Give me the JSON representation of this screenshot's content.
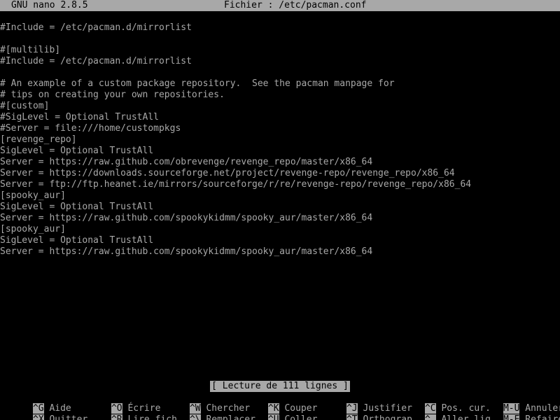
{
  "app": {
    "name_version": "GNU nano 2.8.5",
    "file_label": "Fichier : /etc/pacman.conf"
  },
  "editor": {
    "lines": [
      "#Include = /etc/pacman.d/mirrorlist",
      "",
      "#[multilib]",
      "#Include = /etc/pacman.d/mirrorlist",
      "",
      "# An example of a custom package repository.  See the pacman manpage for",
      "# tips on creating your own repositories.",
      "#[custom]",
      "#SigLevel = Optional TrustAll",
      "#Server = file:///home/custompkgs",
      "[revenge_repo]",
      "SigLevel = Optional TrustAll",
      "Server = https://raw.github.com/obrevenge/revenge_repo/master/x86_64",
      "Server = https://downloads.sourceforge.net/project/revenge-repo/revenge_repo/x86_64",
      "Server = ftp://ftp.heanet.ie/mirrors/sourceforge/r/re/revenge-repo/revenge_repo/x86_64",
      "[spooky_aur]",
      "SigLevel = Optional TrustAll",
      "Server = https://raw.github.com/spookykidmm/spooky_aur/master/x86_64",
      "[spooky_aur]",
      "SigLevel = Optional TrustAll",
      "Server = https://raw.github.com/spookykidmm/spooky_aur/master/x86_64"
    ]
  },
  "status": {
    "message": "[ Lecture de 111 lignes ]"
  },
  "shortcuts": {
    "row1": [
      {
        "key": "^G",
        "label": "Aide"
      },
      {
        "key": "^O",
        "label": "Écrire"
      },
      {
        "key": "^W",
        "label": "Chercher"
      },
      {
        "key": "^K",
        "label": "Couper"
      },
      {
        "key": "^J",
        "label": "Justifier"
      },
      {
        "key": "^C",
        "label": "Pos. cur."
      },
      {
        "key": "M-U",
        "label": "Annuler"
      }
    ],
    "row2": [
      {
        "key": "^X",
        "label": "Quitter"
      },
      {
        "key": "^R",
        "label": "Lire fich."
      },
      {
        "key": "^\\",
        "label": "Remplacer"
      },
      {
        "key": "^U",
        "label": "Coller"
      },
      {
        "key": "^T",
        "label": "Orthograp."
      },
      {
        "key": "^_",
        "label": "Aller lig."
      },
      {
        "key": "M-E",
        "label": "Refaire"
      }
    ]
  },
  "colors": {
    "background": "#000000",
    "foreground": "#a8a8a8",
    "inverse_background": "#a8a8a8",
    "inverse_foreground": "#000000"
  }
}
